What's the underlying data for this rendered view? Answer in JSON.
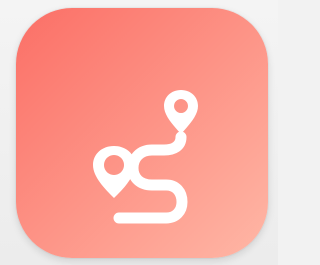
{
  "app_icon": {
    "icon_name": "route-map-icon",
    "glyph_name": "route-path-icon",
    "colors": {
      "gradient_start": "#fb6f66",
      "gradient_end": "#ffb7a6",
      "glyph": "#ffffff"
    }
  }
}
